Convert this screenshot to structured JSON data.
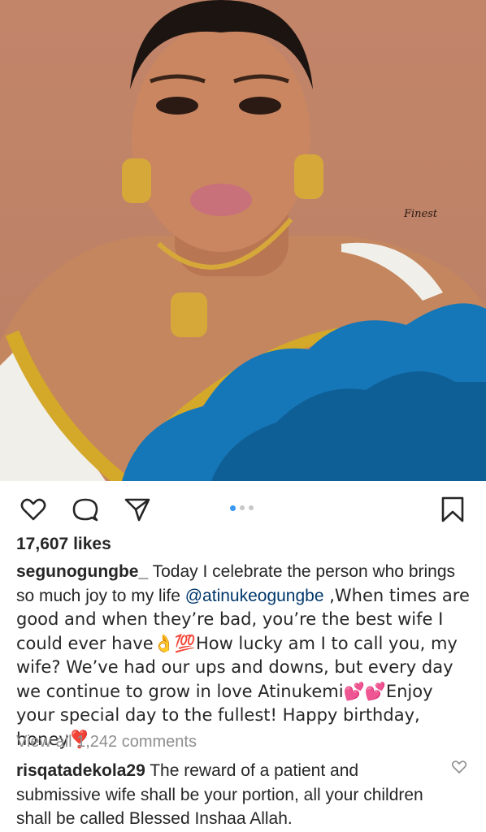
{
  "photo": {
    "watermark": "Finest",
    "carousel_count": 3,
    "carousel_active": 1
  },
  "actions": {
    "icons": [
      "heart-icon",
      "comment-icon",
      "share-icon",
      "bookmark-icon"
    ]
  },
  "post": {
    "likes": "17,607 likes",
    "caption_user": "segunogungbe_",
    "caption_part1": " Today I celebrate the person who brings so much joy to my life ",
    "caption_mention": "@atinukeogungbe",
    "caption_part2": " ,When times are good and when they’re bad, you’re the best wife I could ever have👌💯How lucky am I to call you, my wife?  We’ve had our ups and downs, but every day we continue to grow in love Atinukemi💕💕Enjoy your special day to the fullest! Happy birthday, honey❣️",
    "view_all_comments": "View all 1,242 comments"
  },
  "comment": {
    "user": "risqatadekola29",
    "text": " The reward of a patient and submissive wife shall be  your portion, all your children shall be called Blessed Inshaa Allah."
  },
  "colors": {
    "accent": "#3897f0",
    "text": "#262626",
    "muted": "#8e8e8e",
    "mention": "#00376b"
  }
}
